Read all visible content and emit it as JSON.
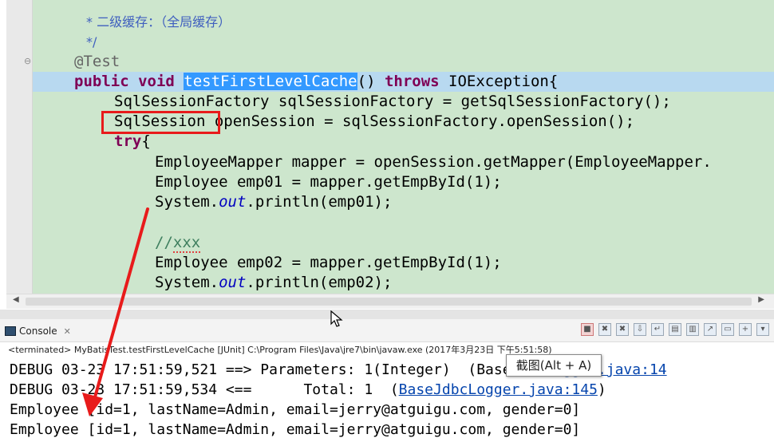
{
  "editor": {
    "lines": {
      "c1": "* 二级缓存：（全局缓存）",
      "c2": "*/",
      "annotation": "@Test",
      "sig_kw": "public void ",
      "sig_name": "testFirstLevelCache",
      "sig_mid": "() ",
      "sig_throws": "throws",
      "sig_end": " IOException{",
      "l_factory": "SqlSessionFactory sqlSessionFactory = getSqlSessionFactory();",
      "l_session_type": "SqlSession",
      "l_session_rest": " openSession = sqlSessionFactory.openSession();",
      "l_try": "try",
      "l_try_brace": "{",
      "l_mapper": "EmployeeMapper mapper = openSession.getMapper(EmployeeMapper.",
      "l_emp01": "Employee emp01 = mapper.getEmpById(1);",
      "l_print1_a": "System.",
      "l_print1_out": "out",
      "l_print1_b": ".println(emp01);",
      "l_comment": "//",
      "l_comment_word": "xxx",
      "l_emp02": "Employee emp02 = mapper.getEmpById(1);",
      "l_print2_a": "System.",
      "l_print2_out": "out",
      "l_print2_b": ".println(emp02);"
    }
  },
  "console": {
    "tab_label": "Console",
    "terminated": "<terminated> MyBatisTest.testFirstLevelCache [JUnit] C:\\Program Files\\Java\\jre7\\bin\\javaw.exe (2017年3月23日 下午5:51:58)",
    "out1_a": "DEBUG 03-23 17:51:59,521 ==> Parameters: 1(Integer)  (Base",
    "out1_link": "JdbcLogger.java:14",
    "out2_a": "DEBUG 03-23 17:51:59,534 <==      Total: 1  (",
    "out2_link": "BaseJdbcLogger.java:145",
    "out2_b": ")",
    "out3": "Employee [id=1, lastName=Admin, email=jerry@atguigu.com, gender=0]",
    "out4": "Employee [id=1, lastName=Admin, email=jerry@atguigu.com, gender=0]"
  },
  "tooltip": "截图(Alt + A)",
  "colors": {
    "annotation_red": "#e81b1b",
    "editor_bg": "#cde6cd",
    "selection": "#3399ff"
  }
}
